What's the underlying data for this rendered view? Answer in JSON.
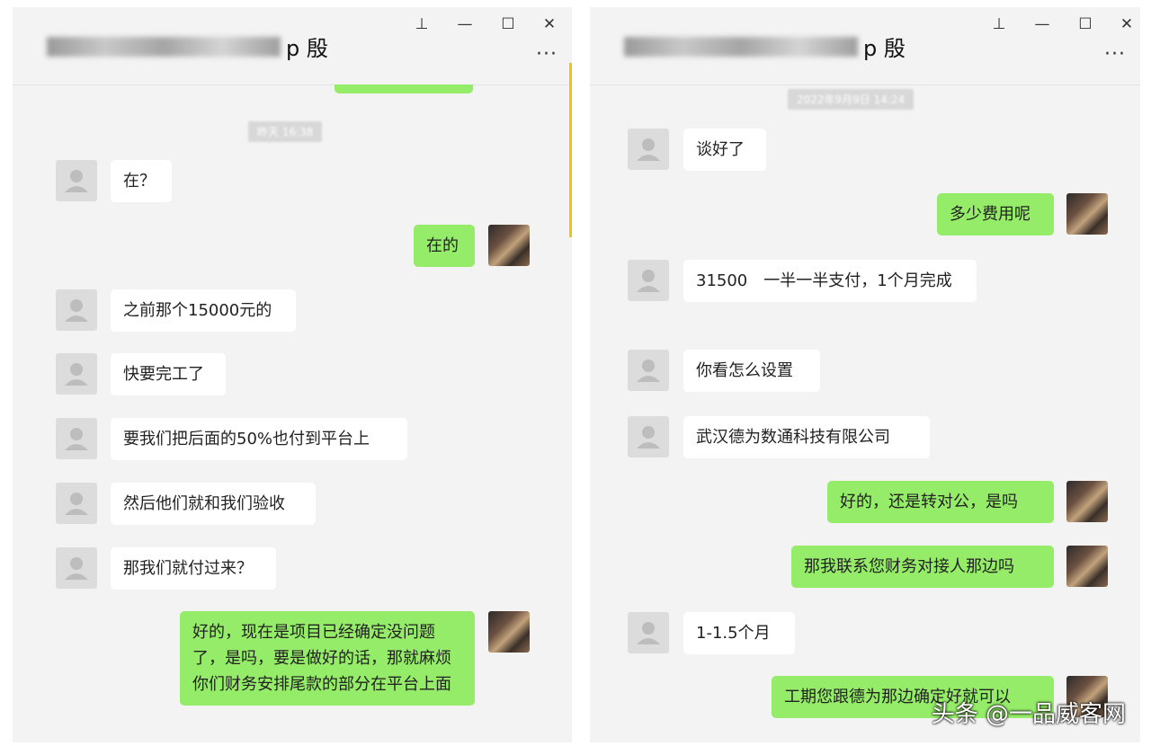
{
  "left_window": {
    "title_surname": "p 殷",
    "timestamp": "昨天 16:38",
    "messages": [
      {
        "side": "in",
        "text": "在？"
      },
      {
        "side": "out",
        "text": "在的"
      },
      {
        "side": "in",
        "text": "之前那个15000元的"
      },
      {
        "side": "in",
        "text": "快要完工了"
      },
      {
        "side": "in",
        "text": "要我们把后面的50%也付到平台上"
      },
      {
        "side": "in",
        "text": "然后他们就和我们验收"
      },
      {
        "side": "in",
        "text": "那我们就付过来？"
      },
      {
        "side": "out",
        "text": "好的，现在是项目已经确定没问题了，是吗，要是做好的话，那就麻烦你们财务安排尾款的部分在平台上面"
      }
    ]
  },
  "right_window": {
    "title_surname": "p 殷",
    "timestamp": "2022年9月9日 14:24",
    "messages": [
      {
        "side": "in",
        "text": "谈好了"
      },
      {
        "side": "out",
        "text": "多少费用呢"
      },
      {
        "side": "in",
        "text": "31500　一半一半支付，1个月完成"
      },
      {
        "side": "in",
        "text": "你看怎么设置"
      },
      {
        "side": "in",
        "text": "武汉德为数通科技有限公司"
      },
      {
        "side": "out",
        "text": "好的，还是转对公，是吗"
      },
      {
        "side": "out",
        "text": "那我联系您财务对接人那边吗"
      },
      {
        "side": "in",
        "text": "1-1.5个月"
      },
      {
        "side": "out",
        "text": "工期您跟德为那边确定好就可以"
      }
    ]
  },
  "window_controls": {
    "pin": "⊥",
    "minimize": "—",
    "maximize": "☐",
    "close": "✕",
    "more": "···"
  },
  "watermark": "头条 @一品威客网",
  "colors": {
    "outgoing_bubble": "#95ec69",
    "incoming_bubble": "#ffffff",
    "window_bg": "#f3f3f3"
  },
  "icons": {
    "avatar_default": "person-silhouette-icon"
  }
}
